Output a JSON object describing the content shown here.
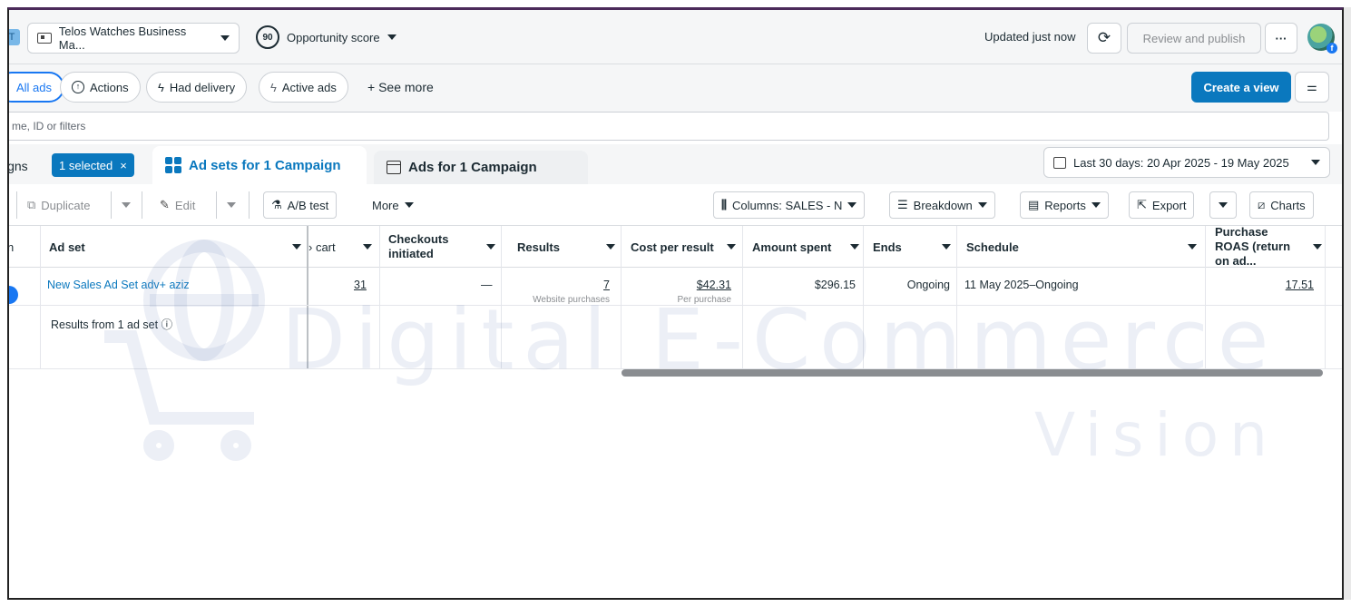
{
  "topbar": {
    "account_chip": "T",
    "account_name": "Telos Watches Business Ma...",
    "opportunity_score": "90",
    "opportunity_label": "Opportunity score",
    "updated": "Updated just now",
    "review_label": "Review and publish",
    "more_label": "···"
  },
  "filters": {
    "items": [
      {
        "label": "All ads",
        "icon": "",
        "active": true
      },
      {
        "label": "Actions",
        "icon": "arrow-up-circle-icon"
      },
      {
        "label": "Had delivery",
        "icon": "lightning-icon"
      },
      {
        "label": "Active ads",
        "icon": "lightning-icon"
      }
    ],
    "see_more": "+ See more",
    "create_view": "Create a view"
  },
  "search": {
    "placeholder": "me, ID or filters"
  },
  "tabs": {
    "campaigns_label": "igns",
    "selected_chip": "1 selected",
    "chip_close": "×",
    "adsets_label": "Ad sets for 1 Campaign",
    "ads_label": "Ads for 1 Campaign",
    "date_range": "Last 30 days: 20 Apr 2025 - 19 May 2025"
  },
  "toolbar": {
    "duplicate": "Duplicate",
    "edit": "Edit",
    "ab_test": "A/B test",
    "more": "More",
    "columns": "Columns: SALES - N",
    "breakdown": "Breakdown",
    "reports": "Reports",
    "export": "Export",
    "charts": "Charts"
  },
  "table": {
    "headers": {
      "first": "n",
      "ad_set": "Ad set",
      "cart": "› cart",
      "checkouts": "Checkouts initiated",
      "results": "Results",
      "cost_per_result": "Cost per result",
      "amount_spent": "Amount spent",
      "ends": "Ends",
      "schedule": "Schedule",
      "roas": "Purchase ROAS (return on ad..."
    },
    "row": {
      "ad_set_name": "New Sales Ad Set adv+ aziz",
      "cart": "31",
      "checkouts": "—",
      "results": "7",
      "results_sub": "Website purchases",
      "cost": "$42.31",
      "cost_sub": "Per purchase",
      "amount": "$296.15",
      "ends": "Ongoing",
      "schedule": "11 May 2025–Ongoing",
      "roas": "17.51"
    },
    "summary": "Results from 1 ad set",
    "summary_icon": "ⓘ"
  },
  "watermark": {
    "line1": "Digital E-Commerce",
    "line2": "Vision"
  },
  "colors": {
    "accent": "#0a78be",
    "brand_blue": "#1877f2"
  }
}
